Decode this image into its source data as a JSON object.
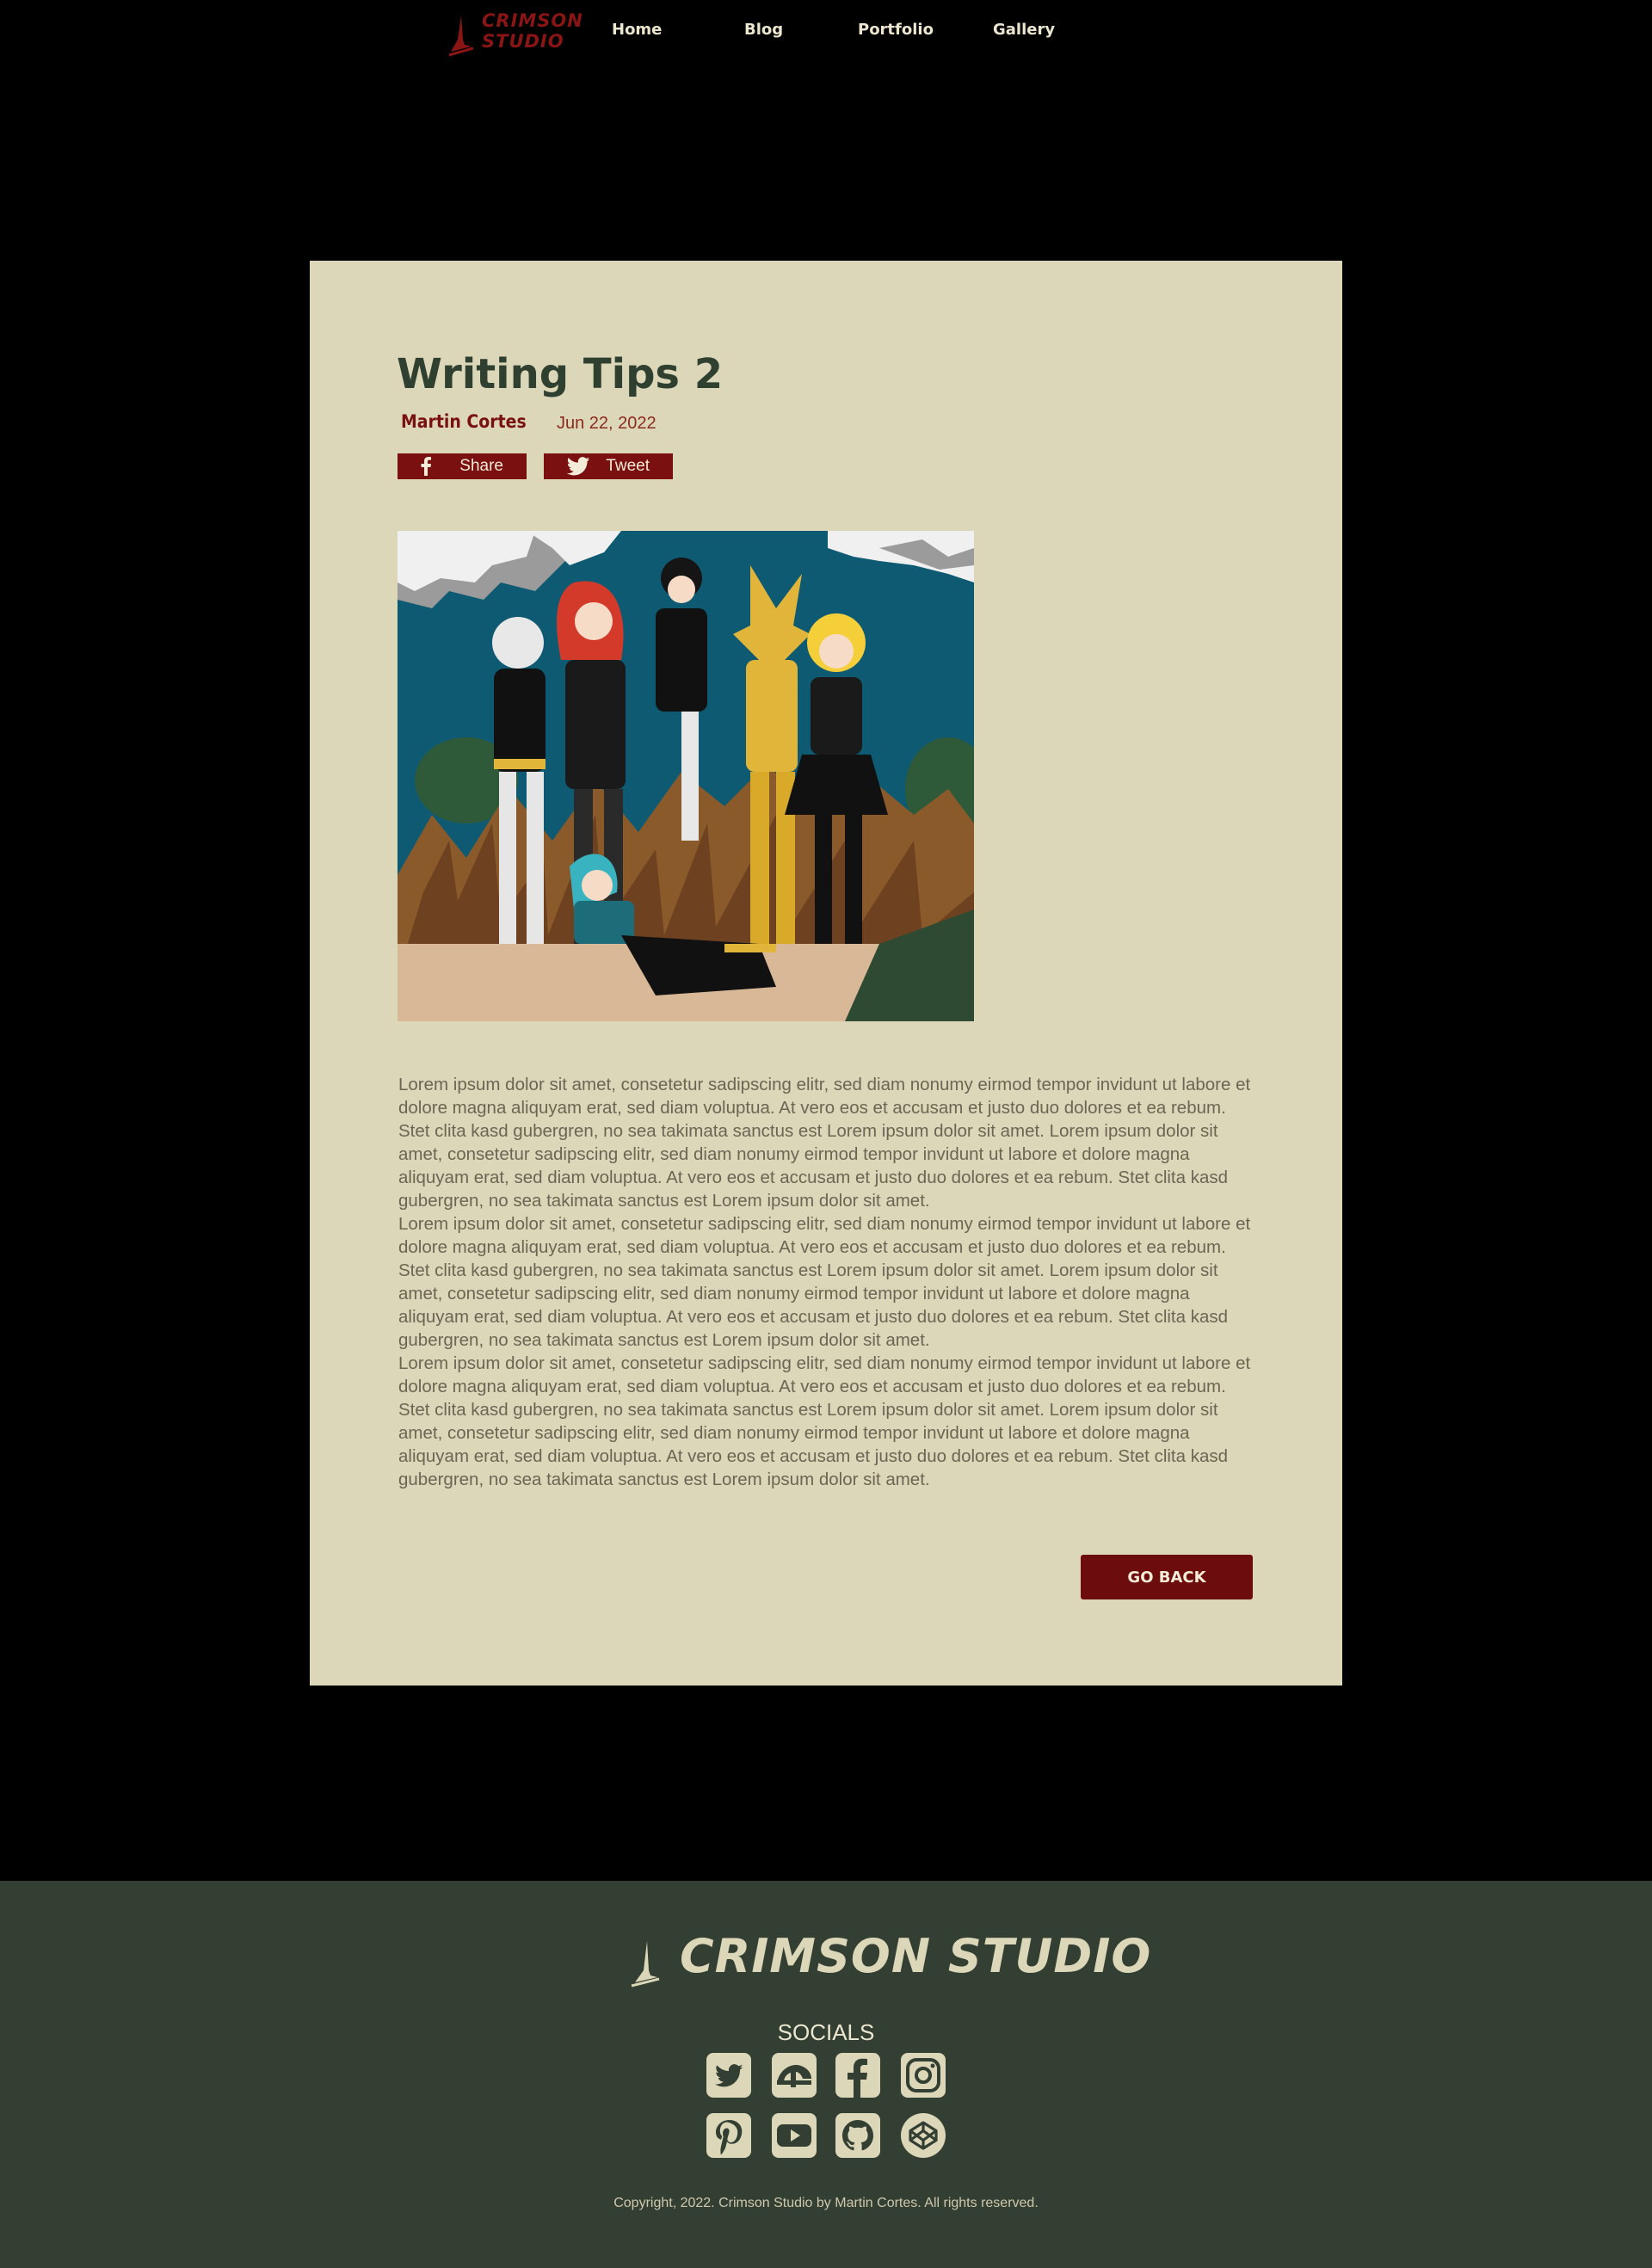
{
  "header": {
    "logo_line1": "CRIMSON",
    "logo_line2": "STUDIO",
    "nav": [
      "Home",
      "Blog",
      "Portfolio",
      "Gallery"
    ]
  },
  "post": {
    "title": "Writing Tips 2",
    "author": "Martin Cortes",
    "date": "Jun 22, 2022",
    "share_label": "Share",
    "tweet_label": "Tweet",
    "image_alt": "illustration of a group of costumed characters in front of a canyon",
    "paragraphs": [
      "Lorem ipsum dolor sit amet, consetetur sadipscing elitr, sed diam nonumy eirmod tempor invidunt ut labore et dolore magna aliquyam erat, sed diam voluptua. At vero eos et accusam et justo duo dolores et ea rebum. Stet clita kasd gubergren, no sea takimata sanctus est Lorem ipsum dolor sit amet. Lorem ipsum dolor sit amet, consetetur sadipscing elitr, sed diam nonumy eirmod tempor invidunt ut labore et dolore magna aliquyam erat, sed diam voluptua. At vero eos et accusam et justo duo dolores et ea rebum. Stet clita kasd gubergren, no sea takimata sanctus est Lorem ipsum dolor sit amet.",
      "Lorem ipsum dolor sit amet, consetetur sadipscing elitr, sed diam nonumy eirmod tempor invidunt ut labore et dolore magna aliquyam erat, sed diam voluptua. At vero eos et accusam et justo duo dolores et ea rebum. Stet clita kasd gubergren, no sea takimata sanctus est Lorem ipsum dolor sit amet. Lorem ipsum dolor sit amet, consetetur sadipscing elitr, sed diam nonumy eirmod tempor invidunt ut labore et dolore magna aliquyam erat, sed diam voluptua. At vero eos et accusam et justo duo dolores et ea rebum. Stet clita kasd gubergren, no sea takimata sanctus est Lorem ipsum dolor sit amet.",
      "Lorem ipsum dolor sit amet, consetetur sadipscing elitr, sed diam nonumy eirmod tempor invidunt ut labore et dolore magna aliquyam erat, sed diam voluptua. At vero eos et accusam et justo duo dolores et ea rebum. Stet clita kasd gubergren, no sea takimata sanctus est Lorem ipsum dolor sit amet. Lorem ipsum dolor sit amet, consetetur sadipscing elitr, sed diam nonumy eirmod tempor invidunt ut labore et dolore magna aliquyam erat, sed diam voluptua. At vero eos et accusam et justo duo dolores et ea rebum. Stet clita kasd gubergren, no sea takimata sanctus est Lorem ipsum dolor sit amet."
    ],
    "go_back": "GO BACK"
  },
  "footer": {
    "brand": "CRIMSON STUDIO",
    "socials_heading": "SOCIALS",
    "socials": [
      "twitter-icon",
      "deviantart-icon",
      "facebook-icon",
      "instagram-icon",
      "pinterest-icon",
      "youtube-icon",
      "github-icon",
      "codepen-icon"
    ],
    "copyright": "Copyright, 2022. Crimson Studio by Martin Cortes. All rights reserved."
  },
  "colors": {
    "background": "#000000",
    "card": "#ddd7b9",
    "accent": "#7a1010",
    "heading": "#2f3f30",
    "footer": "#323f32",
    "footer_text": "#ece5cf"
  }
}
